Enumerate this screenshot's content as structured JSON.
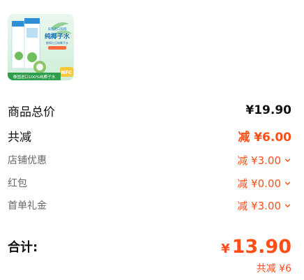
{
  "product": {
    "image_texts": {
      "brand_top": "泰国进口鲜椰",
      "title": "纯椰子水",
      "subtitle": "鲜榨白玉纯椰子水",
      "badge": "NFC",
      "bottom": "泰国进口100%纯椰子水"
    }
  },
  "summary": {
    "goods_total": {
      "label": "商品总价",
      "value": "¥19.90"
    },
    "total_discount": {
      "label": "共减",
      "value": "减 ¥6.00"
    },
    "shop_discount": {
      "label": "店铺优惠",
      "value": "减 ¥3.00"
    },
    "red_packet": {
      "label": "红包",
      "value": "减 ¥0.00"
    },
    "first_order_gift": {
      "label": "首单礼金",
      "value": "减 ¥3.00"
    }
  },
  "total": {
    "label": "合计:",
    "currency": "¥",
    "amount": "13.90",
    "saved": "共减 ¥6"
  },
  "colors": {
    "accent": "#ff4e18",
    "text": "#111111",
    "muted": "#666666"
  }
}
